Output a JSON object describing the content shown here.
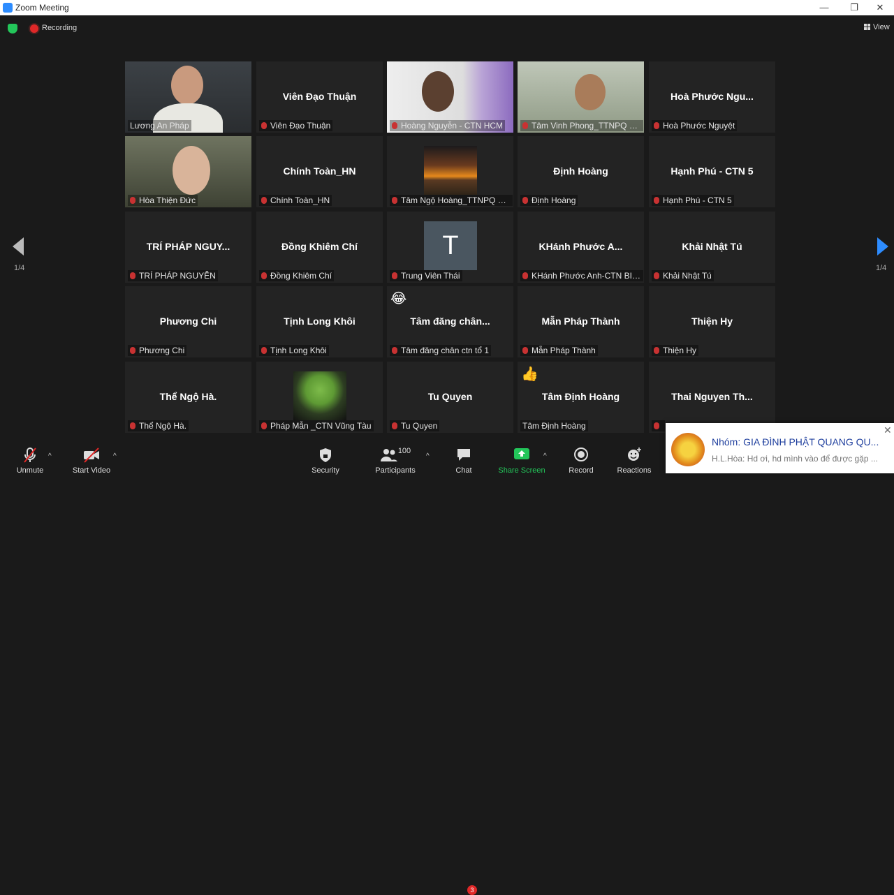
{
  "window": {
    "title": "Zoom Meeting",
    "minimize": "—",
    "restore": "❐",
    "close": "✕"
  },
  "topbar": {
    "recording_label": "Recording",
    "view_label": "View"
  },
  "pager": {
    "left_page": "1/4",
    "right_page": "1/4"
  },
  "tiles": [
    {
      "center": "",
      "label": "Lương An Pháp"
    },
    {
      "center": "Viên Đạo Thuận",
      "label": "Viên Đạo Thuận"
    },
    {
      "center": "",
      "label": "Hoàng Nguyễn - CTN HCM"
    },
    {
      "center": "",
      "label": "Tâm Vinh Phong_TTNPQ Đ..."
    },
    {
      "center": "Hoà Phước Ngu...",
      "label": "Hoà Phước Nguyệt"
    },
    {
      "center": "",
      "label": "Hòa Thiện Đức"
    },
    {
      "center": "Chính Toàn_HN",
      "label": "Chính Toàn_HN"
    },
    {
      "center": "",
      "label": "Tâm Ngộ Hoàng_TTNPQ N..."
    },
    {
      "center": "Định Hoàng",
      "label": "Định Hoàng"
    },
    {
      "center": "Hạnh Phú - CTN 5",
      "label": "Hạnh Phú - CTN 5"
    },
    {
      "center": "TRÍ PHÁP NGUY...",
      "label": "TRÍ PHÁP NGUYỄN"
    },
    {
      "center": "Đồng Khiêm Chí",
      "label": "Đồng Khiêm Chí"
    },
    {
      "center": "T",
      "label": "Trung Viên Thái"
    },
    {
      "center": "KHánh Phước A...",
      "label": "KHánh Phước Anh-CTN BIÊ..."
    },
    {
      "center": "Khải Nhật Tú",
      "label": "Khải Nhật Tú"
    },
    {
      "center": "Phương Chi",
      "label": "Phương Chi"
    },
    {
      "center": "Tịnh Long Khôi",
      "label": "Tịnh Long Khôi"
    },
    {
      "center": "Tâm đăng chân...",
      "label": "Tâm đăng chân ctn tổ 1"
    },
    {
      "center": "Mẫn Pháp Thành",
      "label": "Mẫn Pháp Thành"
    },
    {
      "center": "Thiện Hy",
      "label": "Thiện Hy"
    },
    {
      "center": "Thể Ngộ Hà.",
      "label": "Thể Ngộ Hà."
    },
    {
      "center": "",
      "label": "Pháp Mẫn _CTN Vũng Tàu"
    },
    {
      "center": "Tu Quyen",
      "label": "Tu Quyen"
    },
    {
      "center": "Tâm Định Hoàng",
      "label": "Tâm Định Hoàng"
    },
    {
      "center": "Thai Nguyen Th...",
      "label": ""
    }
  ],
  "reactions": {
    "laugh": "😂",
    "thumbs": "👍"
  },
  "toolbar": {
    "unmute": "Unmute",
    "start_video": "Start Video",
    "security": "Security",
    "participants": "Participants",
    "participants_count": "100",
    "chat": "Chat",
    "chat_badge": "3",
    "share_screen": "Share Screen",
    "record": "Record",
    "reactions": "Reactions"
  },
  "notification": {
    "title": "Nhóm: GIA ĐÌNH PHẬT QUANG QU...",
    "message": "H.L.Hòa: Hd ơi, hd mình vào để được gặp ...",
    "close": "✕"
  },
  "colors": {
    "accent": "#2d8cff",
    "active_border": "#d4e35a",
    "mute_red": "#c83232",
    "share_green": "#23c65a",
    "tile_bg": "#232323"
  }
}
